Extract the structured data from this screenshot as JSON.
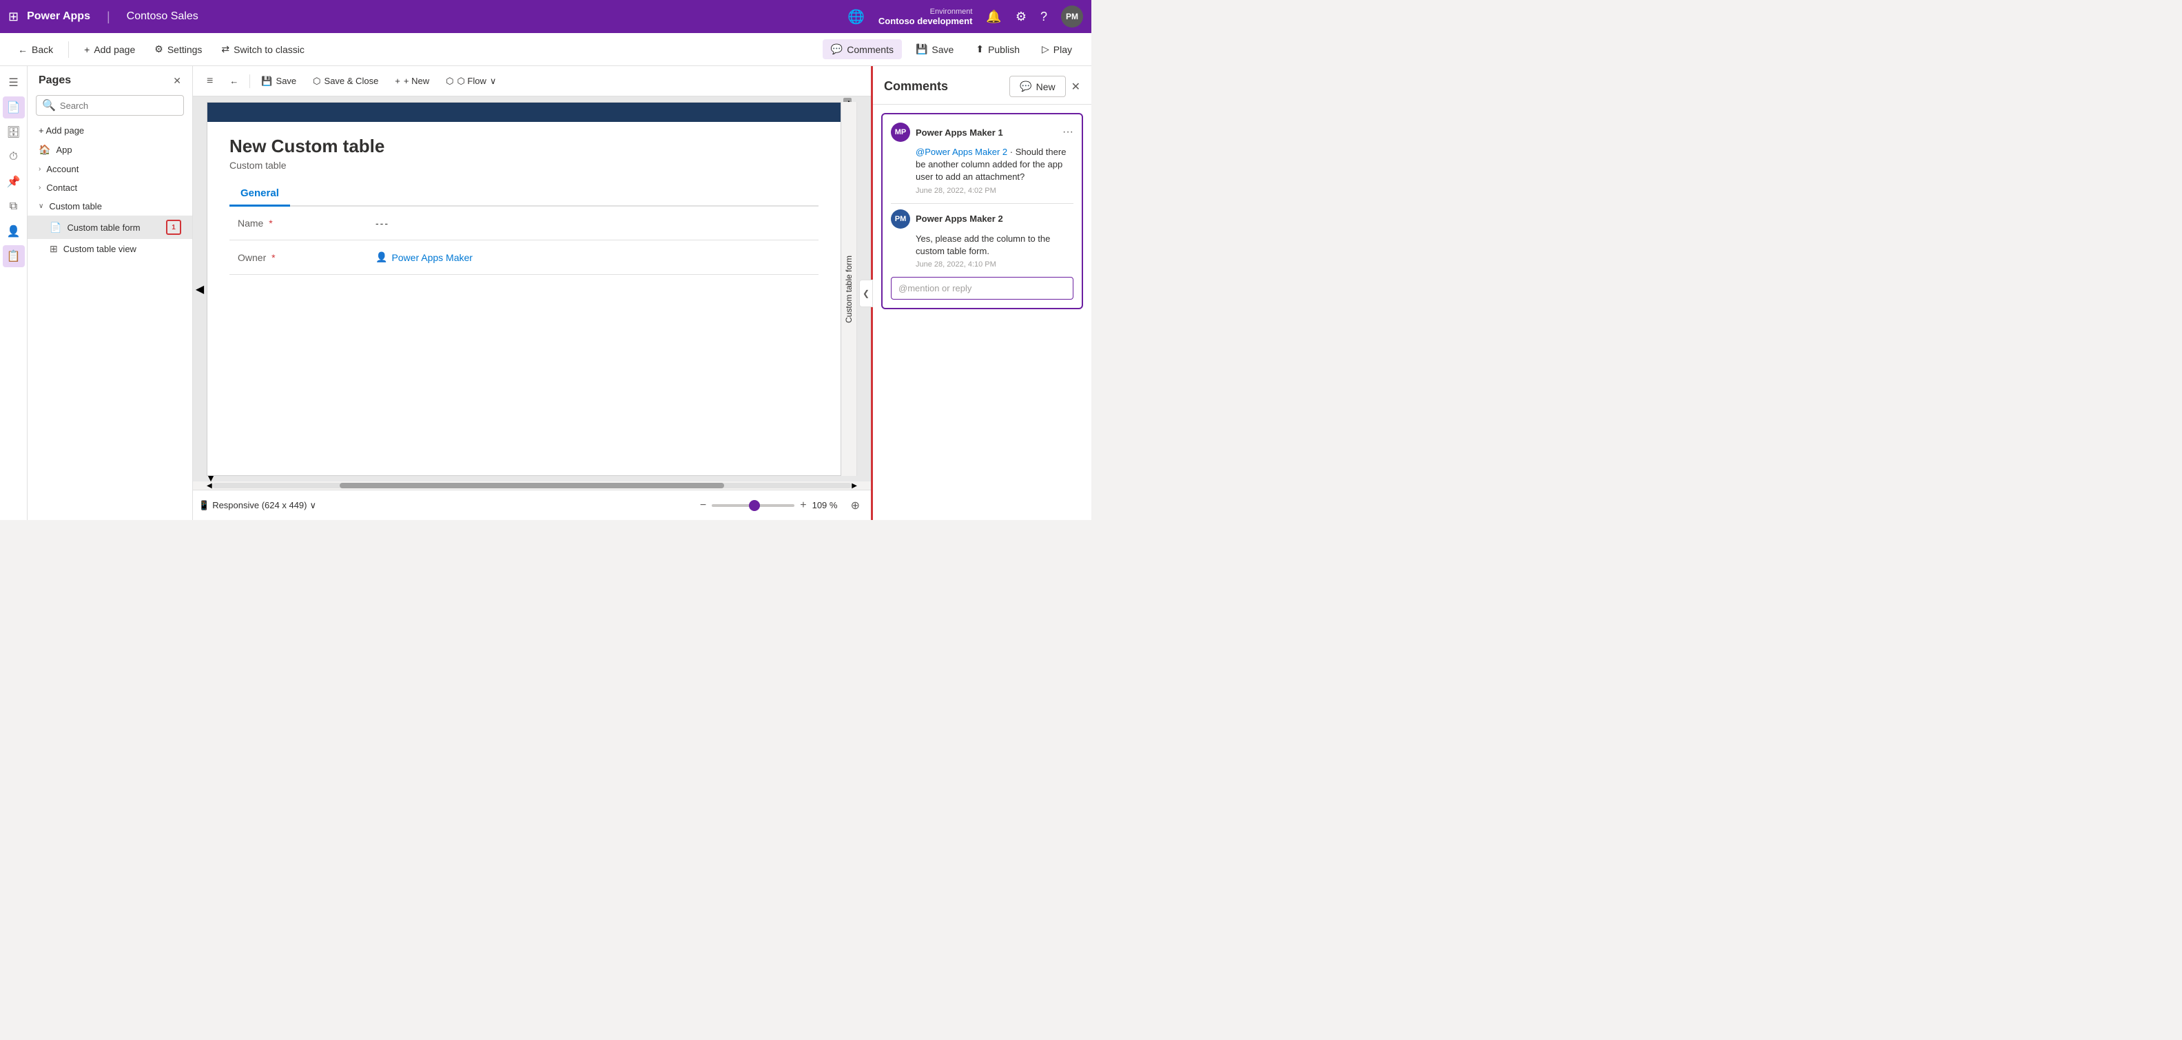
{
  "topNav": {
    "gridIcon": "⊞",
    "appTitle": "Power Apps",
    "separator": "|",
    "appName": "Contoso Sales",
    "environment": {
      "label": "Environment",
      "name": "Contoso development"
    },
    "bellIcon": "🔔",
    "gearIcon": "⚙",
    "helpIcon": "?",
    "avatarLabel": "PM"
  },
  "secondToolbar": {
    "backLabel": "Back",
    "addPageLabel": "Add page",
    "settingsLabel": "Settings",
    "switchLabel": "Switch to classic",
    "commentsLabel": "Comments",
    "saveLabel": "Save",
    "publishLabel": "Publish",
    "playLabel": "Play"
  },
  "pagesPanel": {
    "title": "Pages",
    "closeIcon": "✕",
    "searchPlaceholder": "Search",
    "addPageLabel": "+ Add page",
    "items": [
      {
        "id": "app",
        "label": "App",
        "icon": "🏠",
        "type": "item",
        "expanded": false
      },
      {
        "id": "account",
        "label": "Account",
        "icon": "›",
        "type": "parent",
        "expanded": false
      },
      {
        "id": "contact",
        "label": "Contact",
        "icon": "›",
        "type": "parent",
        "expanded": false
      },
      {
        "id": "custom-table",
        "label": "Custom table",
        "icon": "∨",
        "type": "parent",
        "expanded": true
      },
      {
        "id": "custom-table-form",
        "label": "Custom table form",
        "icon": "📄",
        "type": "child",
        "badge": "1"
      },
      {
        "id": "custom-table-view",
        "label": "Custom table view",
        "icon": "⊞",
        "type": "child"
      }
    ]
  },
  "leftSidebar": {
    "icons": [
      {
        "id": "hamburger",
        "symbol": "☰",
        "active": false
      },
      {
        "id": "pages",
        "symbol": "📄",
        "active": true
      },
      {
        "id": "data",
        "symbol": "🗄",
        "active": false
      },
      {
        "id": "history",
        "symbol": "⏱",
        "active": false
      },
      {
        "id": "pin",
        "symbol": "📌",
        "active": false
      },
      {
        "id": "copy",
        "symbol": "⧉",
        "active": false
      },
      {
        "id": "person",
        "symbol": "👤",
        "active": false
      },
      {
        "id": "form",
        "symbol": "📋",
        "active": true
      }
    ]
  },
  "canvasToolbar": {
    "dragIcon": "≡",
    "backIcon": "←",
    "saveLabel": "Save",
    "saveCloseLabel": "Save & Close",
    "newLabel": "+ New",
    "flowLabel": "⬡ Flow",
    "dropdownIcon": "∨",
    "scrollLeft": "◀",
    "scrollRight": "▶"
  },
  "formContent": {
    "title": "New Custom table",
    "subtitle": "Custom table",
    "tabs": [
      {
        "id": "general",
        "label": "General",
        "active": true
      }
    ],
    "fields": [
      {
        "id": "name",
        "label": "Name",
        "required": true,
        "value": "---",
        "type": "dashes"
      },
      {
        "id": "owner",
        "label": "Owner",
        "required": true,
        "value": "Power Apps Maker",
        "type": "owner"
      }
    ]
  },
  "verticalLabel": "Custom table form",
  "bottomBar": {
    "responsiveLabel": "Responsive (624 x 449)",
    "chevronIcon": "∨",
    "zoomMinus": "−",
    "zoomValue": "109 %",
    "zoomPlus": "+",
    "targetIcon": "⊕",
    "scrollLeftArrow": "◀",
    "scrollRightArrow": "▶"
  },
  "commentsPanel": {
    "title": "Comments",
    "closeIcon": "✕",
    "collapseIcon": "❮",
    "newButtonLabel": "New",
    "newButtonIcon": "💬",
    "comments": [
      {
        "id": "thread-1",
        "author1": {
          "initials": "MP",
          "name": "Power Apps Maker 1",
          "avatarClass": "avatar-mp"
        },
        "text1": "@Power Apps Maker 2· Should there be another column added for the app user to add an attachment?",
        "time1": "June 28, 2022, 4:02 PM",
        "menuIcon": "···",
        "author2": {
          "initials": "PM",
          "name": "Power Apps Maker 2",
          "avatarClass": "avatar-pm"
        },
        "text2": "Yes, please add the column to the custom table form.",
        "time2": "June 28, 2022, 4:10 PM",
        "replyPlaceholder": "@mention or reply"
      }
    ]
  },
  "colors": {
    "brand": "#6b1fa0",
    "red": "#d13438",
    "blue": "#0078d4",
    "darkBlue": "#1e3a5f",
    "lightGray": "#f3f2f1",
    "border": "#e0e0e0"
  }
}
